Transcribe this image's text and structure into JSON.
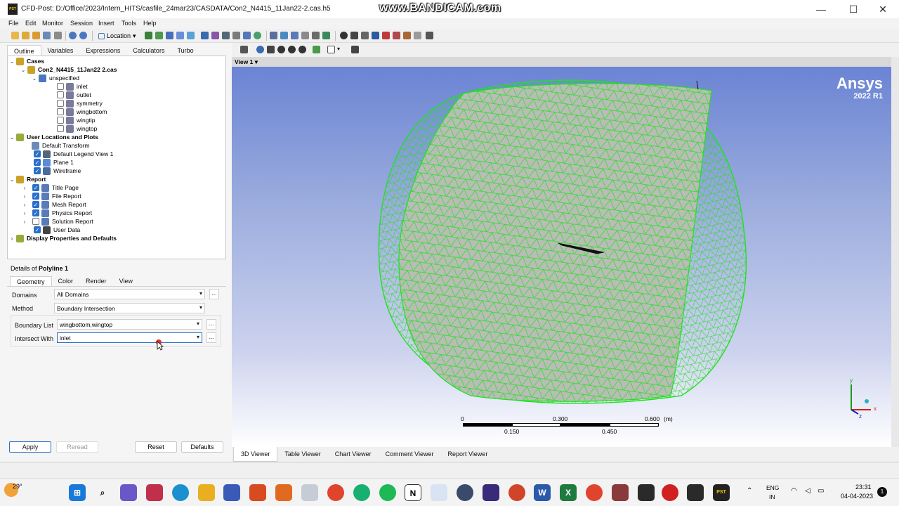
{
  "window": {
    "title": "CFD-Post: D:/Office/2023/Intern_HITS/casfile_24mar23/CASDATA/Con2_N4415_11Jan22-2.cas.h5",
    "app_icon_text": "PST",
    "watermark": "www.BANDICAM.com",
    "minimize": "—",
    "maximize": "☐",
    "close": "✕"
  },
  "menu": [
    "File",
    "Edit",
    "Monitor",
    "Session",
    "Insert",
    "Tools",
    "Help"
  ],
  "toolbar": {
    "location_label": "Location"
  },
  "outline_tabs": [
    "Outline",
    "Variables",
    "Expressions",
    "Calculators",
    "Turbo"
  ],
  "tree": {
    "cases": "Cases",
    "case_file": "Con2_N4415_11Jan22 2.cas",
    "domain": "unspecified",
    "boundaries": [
      "inlet",
      "outlet",
      "symmetry",
      "wingbottom",
      "wingtip",
      "wingtop"
    ],
    "user_locations": "User Locations and Plots",
    "default_transform": "Default Transform",
    "user_items": [
      "Default Legend View 1",
      "Plane 1",
      "Wireframe"
    ],
    "report": "Report",
    "report_items": [
      {
        "label": "Title Page",
        "checked": true
      },
      {
        "label": "File Report",
        "checked": true
      },
      {
        "label": "Mesh Report",
        "checked": true
      },
      {
        "label": "Physics Report",
        "checked": true
      },
      {
        "label": "Solution Report",
        "checked": false
      },
      {
        "label": "User Data",
        "checked": true
      }
    ],
    "display_props": "Display Properties and Defaults"
  },
  "details": {
    "title_prefix": "Details of ",
    "title_object": "Polyline 1",
    "tabs": [
      "Geometry",
      "Color",
      "Render",
      "View"
    ],
    "domains_label": "Domains",
    "domains_value": "All Domains",
    "method_label": "Method",
    "method_value": "Boundary Intersection",
    "boundary_list_label": "Boundary List",
    "boundary_list_value": "wingbottom,wingtop",
    "intersect_label": "Intersect With",
    "intersect_value": "inlet",
    "dots": "...",
    "apply": "Apply",
    "reread": "Reread",
    "reset": "Reset",
    "defaults": "Defaults"
  },
  "viewer": {
    "view_label": "View 1",
    "brand": "Ansys",
    "version": "2022 R1",
    "scale_top": [
      "0",
      "0.300",
      "0.600",
      "(m)"
    ],
    "scale_bottom": [
      "0.150",
      "0.450"
    ],
    "axes": {
      "x": "x",
      "y": "y",
      "z": "z"
    },
    "bottom_tabs": [
      "3D Viewer",
      "Table Viewer",
      "Chart Viewer",
      "Comment Viewer",
      "Report Viewer"
    ]
  },
  "taskbar": {
    "weather": "29°",
    "lang1": "ENG",
    "lang2": "IN",
    "time": "23:31",
    "date": "04-04-2023",
    "notif": "1"
  },
  "colors": {
    "mesh_green": "#22e022",
    "face_grey": "#b9bdb5",
    "accent": "#2a6fc9"
  }
}
